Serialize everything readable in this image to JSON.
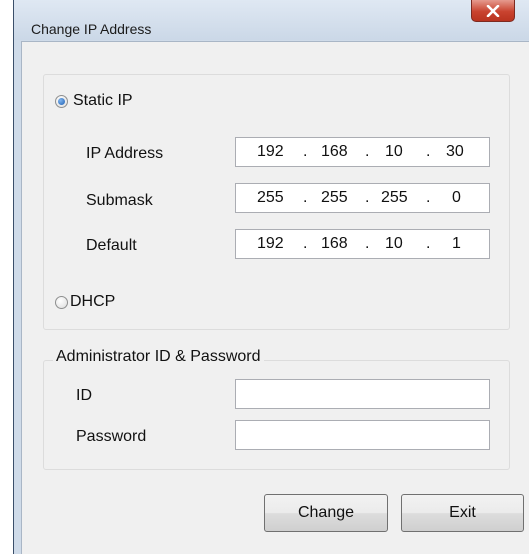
{
  "window": {
    "title": "Change IP Address"
  },
  "static_ip": {
    "label": "Static IP",
    "selected": true,
    "fields": [
      {
        "label": "IP Address",
        "octets": [
          "192",
          "168",
          "10",
          "30"
        ]
      },
      {
        "label": "Submask",
        "octets": [
          "255",
          "255",
          "255",
          "0"
        ]
      },
      {
        "label": "Default",
        "octets": [
          "192",
          "168",
          "10",
          "1"
        ]
      }
    ],
    "separator": "."
  },
  "dhcp": {
    "label": "DHCP",
    "selected": false
  },
  "admin": {
    "legend": "Administrator ID & Password",
    "id_label": "ID",
    "id_value": "",
    "password_label": "Password",
    "password_value": ""
  },
  "buttons": {
    "change": "Change",
    "exit": "Exit"
  },
  "icons": {
    "close": "close-x-icon",
    "radio_selected": "radio-selected-icon",
    "radio_unselected": "radio-unselected-icon"
  }
}
